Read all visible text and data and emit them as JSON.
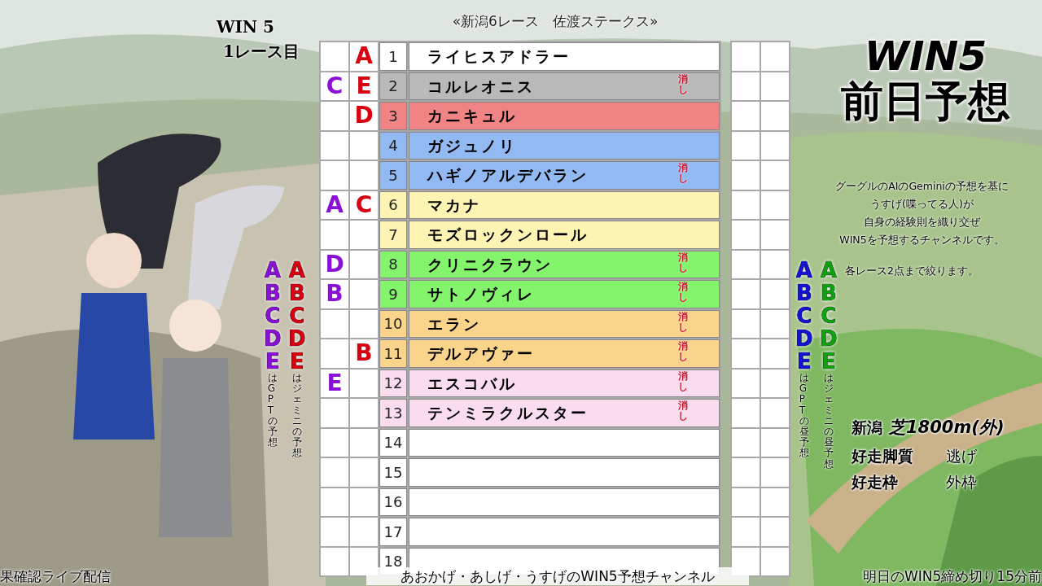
{
  "race_label": {
    "lines": [
      "WIN 5",
      "1レース目"
    ]
  },
  "race_title": "«新潟6レース　佐渡ステークス»",
  "rows": [
    {
      "number": "1",
      "name": "ライヒスアドラー",
      "color": "#ffffff",
      "gemini": "A"
    },
    {
      "number": "2",
      "name": "コルレオニス",
      "color": "#b9b9b9",
      "gpt": "C",
      "gemini": "E",
      "note": "消し"
    },
    {
      "number": "3",
      "name": "カニキュル",
      "color": "#f08484",
      "gemini": "D"
    },
    {
      "number": "4",
      "name": "ガジュノリ",
      "color": "#93b9f2"
    },
    {
      "number": "5",
      "name": "ハギノアルデバラン",
      "color": "#93b9f2",
      "note": "消し"
    },
    {
      "number": "6",
      "name": "マカナ",
      "color": "#fdf3b2",
      "gpt": "A",
      "gemini": "C"
    },
    {
      "number": "7",
      "name": "モズロックンロール",
      "color": "#fdf3b2"
    },
    {
      "number": "8",
      "name": "クリニクラウン",
      "color": "#84f46c",
      "gpt": "D",
      "note": "消し"
    },
    {
      "number": "9",
      "name": "サトノヴィレ",
      "color": "#84f46c",
      "gpt": "B",
      "note": "消し"
    },
    {
      "number": "10",
      "name": "エラン",
      "color": "#f9d48a",
      "note": "消し"
    },
    {
      "number": "11",
      "name": "デルアヴァー",
      "color": "#f9d48a",
      "gemini": "B",
      "note": "消し"
    },
    {
      "number": "12",
      "name": "エスコバル",
      "color": "#f9dcee",
      "gpt": "E",
      "note": "消し"
    },
    {
      "number": "13",
      "name": "テンミラクルスター",
      "color": "#f9dcee",
      "note": "消し"
    },
    {
      "number": "14",
      "color": "#ffffff"
    },
    {
      "number": "15",
      "color": "#ffffff"
    },
    {
      "number": "16",
      "color": "#ffffff"
    },
    {
      "number": "17",
      "color": "#ffffff"
    },
    {
      "number": "18",
      "color": "#ffffff"
    }
  ],
  "legends_left": [
    {
      "letters": [
        "A",
        "B",
        "C",
        "D",
        "E"
      ],
      "color": "#8a10d8",
      "caption": "はGPTの予想"
    },
    {
      "letters": [
        "A",
        "B",
        "C",
        "D",
        "E"
      ],
      "color": "#d80010",
      "caption": "はジェミニの予想"
    }
  ],
  "title": [
    "WIN5",
    "前日予想"
  ],
  "description": [
    "グーグルのAIのGeminiの予想を基に",
    "うすげ(喋ってる人)が",
    "自身の経験則を織り交ぜ",
    "WIN5を予想するチャンネルです。"
  ],
  "legends_right": [
    {
      "letters": [
        "A",
        "B",
        "C",
        "D",
        "E"
      ],
      "color": "#1414d0",
      "caption": "はGPTの昼予想"
    },
    {
      "letters": [
        "A",
        "B",
        "C",
        "D",
        "E"
      ],
      "color": "#10a010",
      "caption": "はジェミニの昼予想"
    }
  ],
  "rule": "各レース2点まで絞ります。",
  "course": {
    "place": "新潟",
    "surface": "芝1800m(外)",
    "stats": [
      {
        "label": "好走脚質",
        "value": "逃げ"
      },
      {
        "label": "好走枠",
        "value": "外枠"
      }
    ]
  },
  "footer": [
    "果確認ライブ配信",
    "あおかげ・あしげ・うすげのWIN5予想チャンネル",
    "明日のWIN5締め切り15分前"
  ]
}
